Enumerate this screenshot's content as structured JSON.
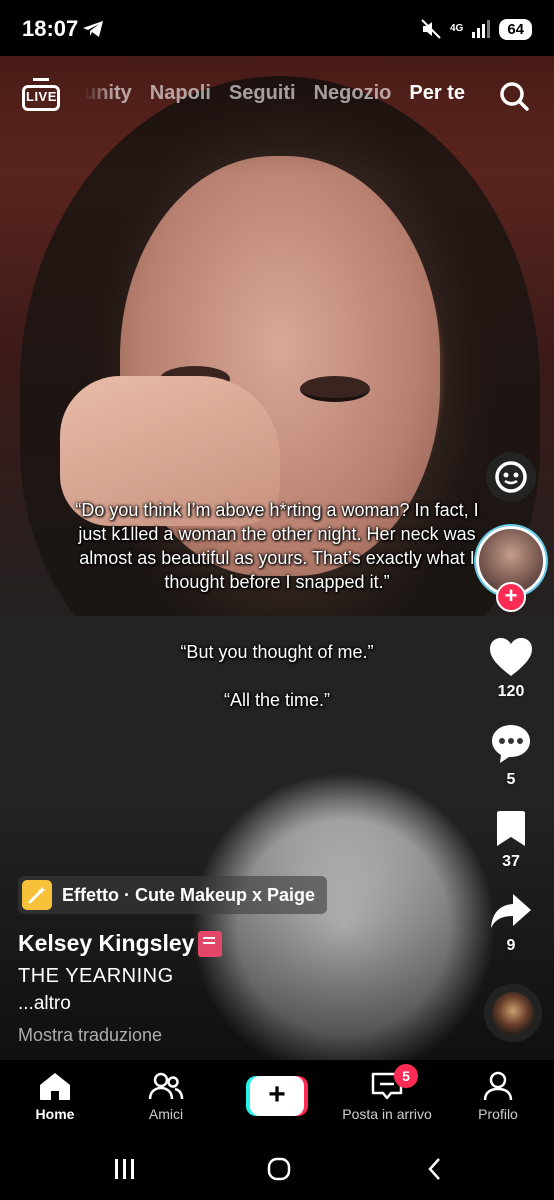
{
  "status_bar": {
    "time": "18:07",
    "network": "4G",
    "battery": "64",
    "icons": [
      "telegram-icon",
      "mute-icon",
      "signal-icon",
      "battery-icon"
    ]
  },
  "top_nav": {
    "live_label": "LIVE",
    "tabs": [
      {
        "label": "unity",
        "active": false
      },
      {
        "label": "Napoli",
        "active": false
      },
      {
        "label": "Seguiti",
        "active": false
      },
      {
        "label": "Negozio",
        "active": false
      },
      {
        "label": "Per te",
        "active": true
      }
    ]
  },
  "subtitles": {
    "line1": "“Do you think I’m above h*rting a woman? In fact, I just k1lled a woman the other night. Her neck was almost as beautiful as yours. That’s exactly what I thought before I snapped it.”",
    "line2": "“But you thought of me.”",
    "line3": "“All the time.”"
  },
  "actions": {
    "likes": "120",
    "comments": "5",
    "bookmarks": "37",
    "shares": "9"
  },
  "post": {
    "effect": "Effetto · Cute Makeup x Paige",
    "author": "Kelsey Kingsley",
    "caption": "THE YEARNING",
    "more": "...altro",
    "translate": "Mostra traduzione"
  },
  "bottom_nav": {
    "home": "Home",
    "friends": "Amici",
    "inbox": "Posta in arrivo",
    "inbox_badge": "5",
    "profile": "Profilo"
  },
  "colors": {
    "accent": "#fe2c55",
    "cyan": "#25f4ee",
    "effect_icon": "#f7c23a",
    "book_icon": "#e2476a"
  }
}
